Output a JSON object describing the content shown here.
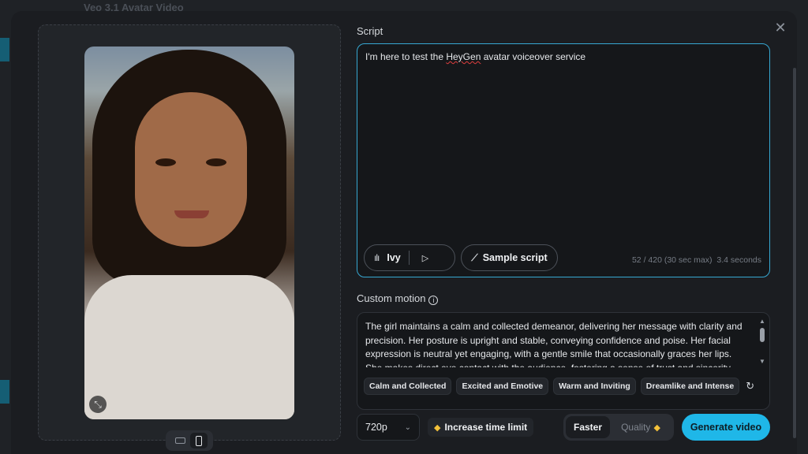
{
  "background": {
    "title": "Veo 3.1 Avatar Video"
  },
  "preview": {
    "expand_icon": "collapse-icon",
    "ratios": [
      {
        "name": "landscape",
        "active": false
      },
      {
        "name": "portrait",
        "active": true
      }
    ]
  },
  "script": {
    "label": "Script",
    "text_before": "I'm here to test the ",
    "text_error": "HeyGen",
    "text_after": " avatar voiceover service",
    "voice_name": "Ivy",
    "sample_label": "Sample script",
    "count": "52 / 420 (30 sec max)",
    "duration": "3.4 seconds"
  },
  "motion": {
    "label": "Custom motion",
    "text": "The girl maintains a calm and collected demeanor, delivering her message with clarity and precision. Her posture is upright and stable, conveying confidence and poise. Her facial expression is neutral yet engaging, with a gentle smile that occasionally graces her lips. She makes direct eye contact with the audience, fostering a sense of trust and sincerity. Her head",
    "presets": [
      "Calm and Collected",
      "Excited and Emotive",
      "Warm and Inviting",
      "Dreamlike and Intense"
    ]
  },
  "controls": {
    "resolution": "720p",
    "time_limit_label": "Increase time limit",
    "speed_faster": "Faster",
    "speed_quality": "Quality",
    "generate_label": "Generate video"
  },
  "colors": {
    "accent": "#1fb7e8",
    "premium": "#f3c13a"
  }
}
